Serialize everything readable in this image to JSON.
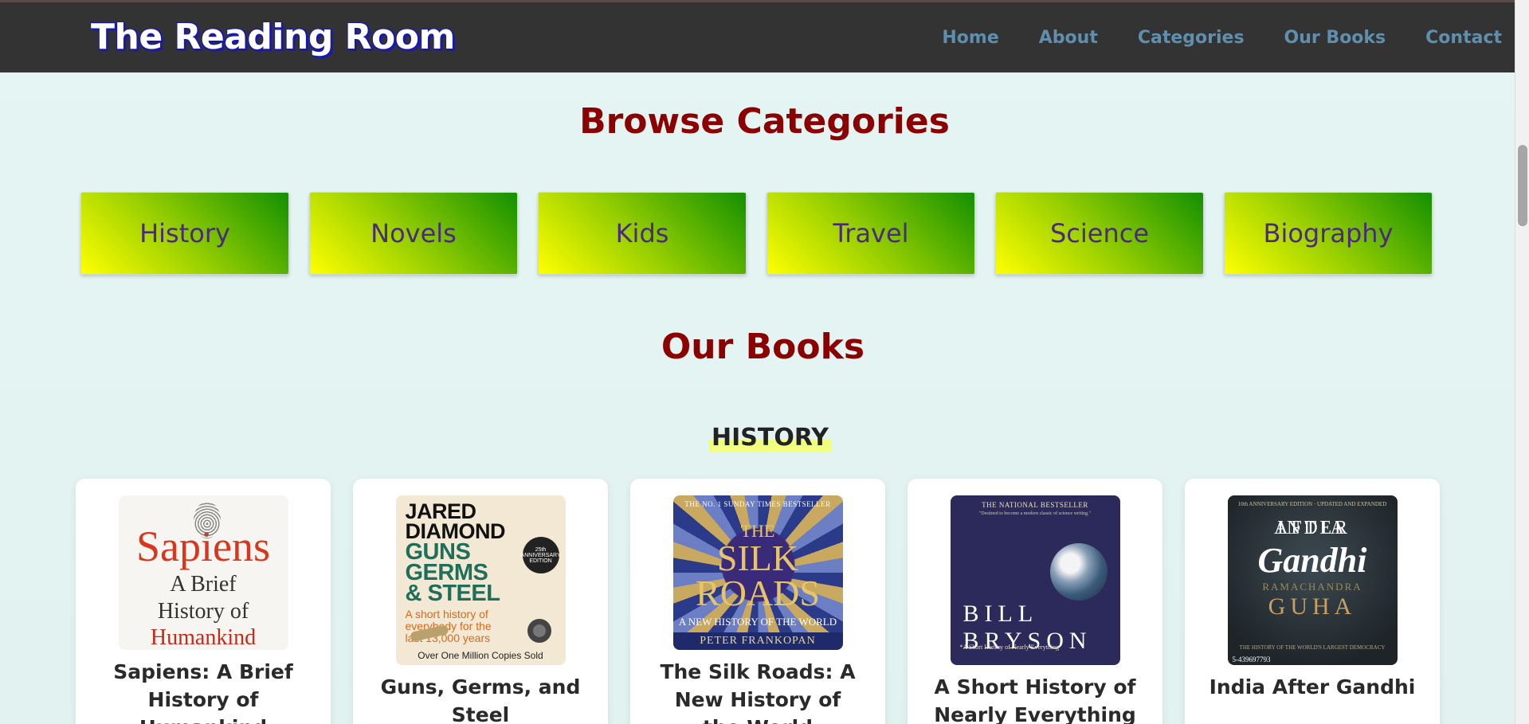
{
  "header": {
    "brand": "The Reading Room",
    "nav": [
      "Home",
      "About",
      "Categories",
      "Our Books",
      "Contact"
    ]
  },
  "categories_section": {
    "title": "Browse Categories",
    "items": [
      "History",
      "Novels",
      "Kids",
      "Travel",
      "Science",
      "Biography"
    ]
  },
  "books_section": {
    "title": "Our Books",
    "subsection": "HISTORY",
    "books": [
      {
        "title": "Sapiens: A Brief History of Humankind",
        "cover": {
          "t1": "Sapiens",
          "t2": "A Brief",
          "t3": "History of",
          "t4": "Humankind"
        }
      },
      {
        "title": "Guns, Germs, and Steel",
        "cover": {
          "author": "JARED DIAMOND",
          "g1": "GUNS",
          "g2": "GERMS",
          "g3": "& STEEL",
          "sub": "A short history of everybody for the last 13,000 years",
          "badge": "25th ANNIVERSARY EDITION",
          "foot": "Over One Million Copies Sold"
        }
      },
      {
        "title": "The Silk Roads: A New History of the World",
        "cover": {
          "top": "THE NO. 1 SUNDAY TIMES BESTSELLER",
          "t1": "THE",
          "t2": "SILK",
          "t3": "ROADS",
          "sub": "A NEW HISTORY OF THE WORLD",
          "author": "PETER FRANKOPAN"
        }
      },
      {
        "title": "A Short History of Nearly Everything",
        "cover": {
          "top": "THE NATIONAL BESTSELLER",
          "quote": "\"Destined to become a modern classic of science writing.\"",
          "n1": "BILL",
          "n2": "BRYSON",
          "foot": "*A Short History of Nearly Everything"
        }
      },
      {
        "title": "India After Gandhi",
        "cover": {
          "top": "10th ANNIVERSARY EDITION · UPDATED AND EXPANDED",
          "t1": "INDIA",
          "t2": "AFTER",
          "t3": "Gandhi",
          "a1": "RAMACHANDRA",
          "a2": "GUHA",
          "foot": "THE HISTORY OF THE WORLD'S LARGEST DEMOCRACY",
          "isbn": "5-439697793"
        }
      }
    ]
  },
  "colors": {
    "nav_bg": "#333333",
    "nav_link": "#5f8fad",
    "section_title": "#8b0000",
    "category_text": "#4b2a7a",
    "page_bg": "#e4f3f1"
  }
}
